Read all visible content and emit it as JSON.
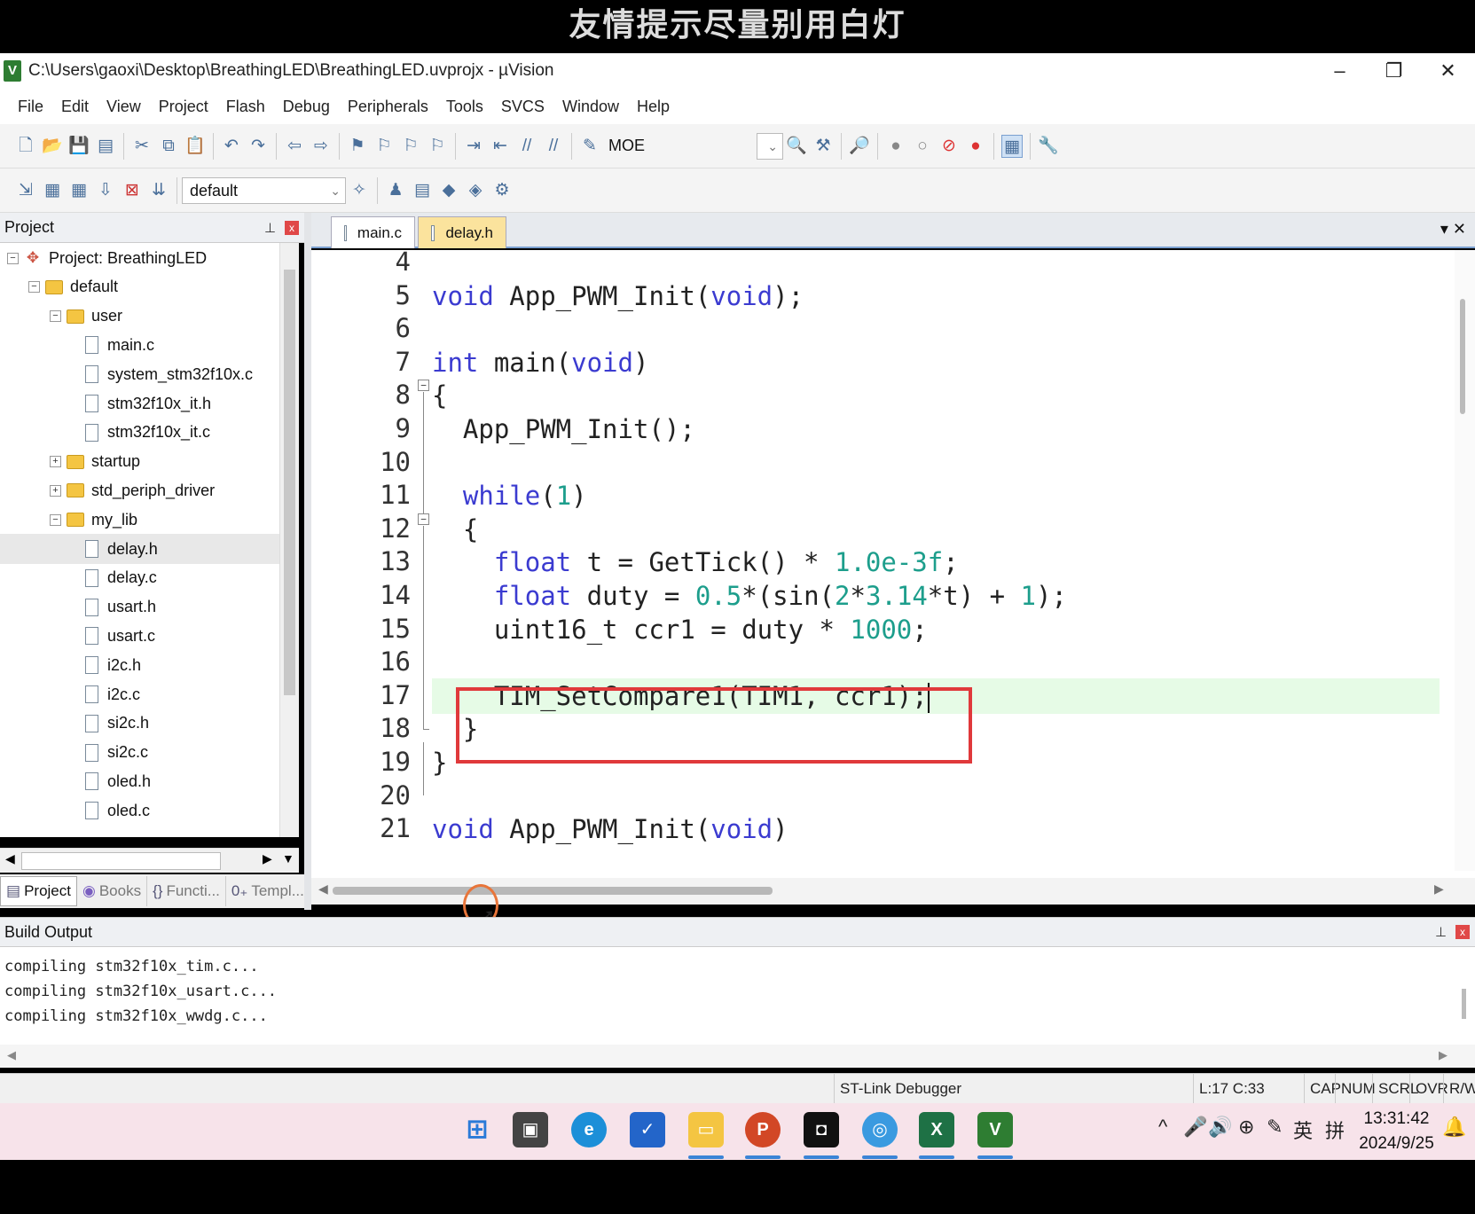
{
  "overlay_banner": "友情提示尽量别用白灯",
  "window": {
    "title": "C:\\Users\\gaoxi\\Desktop\\BreathingLED\\BreathingLED.uvprojx - µVision",
    "app_icon": "V",
    "minimize": "–",
    "restore": "❐",
    "close": "✕"
  },
  "menu": [
    "File",
    "Edit",
    "View",
    "Project",
    "Flash",
    "Debug",
    "Peripherals",
    "Tools",
    "SVCS",
    "Window",
    "Help"
  ],
  "toolbar": {
    "moe_label": "MOE",
    "target_select": "default"
  },
  "project_panel": {
    "title": "Project",
    "pin": "⊥",
    "close": "x",
    "tree": [
      {
        "label": "Project: BreathingLED",
        "type": "project",
        "level": 0,
        "expander": "−"
      },
      {
        "label": "default",
        "type": "group",
        "level": 1,
        "expander": "−"
      },
      {
        "label": "user",
        "type": "folder",
        "level": 2,
        "expander": "−"
      },
      {
        "label": "main.c",
        "type": "file",
        "level": 3
      },
      {
        "label": "system_stm32f10x.c",
        "type": "file",
        "level": 3
      },
      {
        "label": "stm32f10x_it.h",
        "type": "file",
        "level": 3
      },
      {
        "label": "stm32f10x_it.c",
        "type": "file",
        "level": 3
      },
      {
        "label": "startup",
        "type": "folder",
        "level": 2,
        "expander": "+"
      },
      {
        "label": "std_periph_driver",
        "type": "folder",
        "level": 2,
        "expander": "+"
      },
      {
        "label": "my_lib",
        "type": "folder",
        "level": 2,
        "expander": "−"
      },
      {
        "label": "delay.h",
        "type": "file",
        "level": 3,
        "selected": true
      },
      {
        "label": "delay.c",
        "type": "file",
        "level": 3
      },
      {
        "label": "usart.h",
        "type": "file",
        "level": 3
      },
      {
        "label": "usart.c",
        "type": "file",
        "level": 3
      },
      {
        "label": "i2c.h",
        "type": "file",
        "level": 3
      },
      {
        "label": "i2c.c",
        "type": "file",
        "level": 3
      },
      {
        "label": "si2c.h",
        "type": "file",
        "level": 3
      },
      {
        "label": "si2c.c",
        "type": "file",
        "level": 3
      },
      {
        "label": "oled.h",
        "type": "file",
        "level": 3
      },
      {
        "label": "oled.c",
        "type": "file",
        "level": 3
      }
    ],
    "tabs": [
      "Project",
      "Books",
      "Functi...",
      "Templ..."
    ],
    "tab_icons": [
      "▤",
      "◉",
      "{}",
      "0₊"
    ]
  },
  "editor": {
    "tabs": [
      "main.c",
      "delay.h"
    ],
    "tab_controls": "▾  ✕",
    "lines": [
      {
        "n": "4",
        "code": []
      },
      {
        "n": "5",
        "code": [
          [
            "kw",
            "void"
          ],
          [
            "",
            " App_PWM_Init("
          ],
          [
            "kw",
            "void"
          ],
          [
            "",
            ");"
          ]
        ]
      },
      {
        "n": "6",
        "code": []
      },
      {
        "n": "7",
        "code": [
          [
            "kw",
            "int"
          ],
          [
            "",
            " main("
          ],
          [
            "kw",
            "void"
          ],
          [
            "",
            ")"
          ]
        ]
      },
      {
        "n": "8",
        "code": [
          [
            "",
            "{"
          ]
        ]
      },
      {
        "n": "9",
        "code": [
          [
            "",
            "  App_PWM_Init();"
          ]
        ]
      },
      {
        "n": "10",
        "code": []
      },
      {
        "n": "11",
        "code": [
          [
            "",
            "  "
          ],
          [
            "kw",
            "while"
          ],
          [
            "",
            "("
          ],
          [
            "num",
            "1"
          ],
          [
            "",
            ")"
          ]
        ]
      },
      {
        "n": "12",
        "code": [
          [
            "",
            "  {"
          ]
        ]
      },
      {
        "n": "13",
        "code": [
          [
            "",
            "    "
          ],
          [
            "kw",
            "float"
          ],
          [
            "",
            " t = GetTick() * "
          ],
          [
            "num",
            "1.0e-3f"
          ],
          [
            "",
            ";"
          ]
        ]
      },
      {
        "n": "14",
        "code": [
          [
            "",
            "    "
          ],
          [
            "kw",
            "float"
          ],
          [
            "",
            " duty = "
          ],
          [
            "num",
            "0.5"
          ],
          [
            "",
            "*(sin("
          ],
          [
            "num",
            "2"
          ],
          [
            "",
            "*"
          ],
          [
            "num",
            "3.14"
          ],
          [
            "",
            "*t) + "
          ],
          [
            "num",
            "1"
          ],
          [
            "",
            ");"
          ]
        ]
      },
      {
        "n": "15",
        "code": [
          [
            "",
            "    uint16_t ccr1 = duty * "
          ],
          [
            "num",
            "1000"
          ],
          [
            "",
            ";"
          ]
        ]
      },
      {
        "n": "16",
        "code": []
      },
      {
        "n": "17",
        "code": [
          [
            "",
            "    TIM_SetCompare1(TIM1, ccr1);"
          ]
        ],
        "current": true
      },
      {
        "n": "18",
        "code": [
          [
            "",
            "  }"
          ]
        ]
      },
      {
        "n": "19",
        "code": [
          [
            "",
            "}"
          ]
        ]
      },
      {
        "n": "20",
        "code": []
      },
      {
        "n": "21",
        "code": [
          [
            "kw",
            "void"
          ],
          [
            "",
            " App_PWM_Init("
          ],
          [
            "kw",
            "void"
          ],
          [
            "",
            ")"
          ]
        ]
      }
    ]
  },
  "build_output": {
    "title": "Build Output",
    "lines": [
      "compiling stm32f10x_tim.c...",
      "compiling stm32f10x_usart.c...",
      "compiling stm32f10x_wwdg.c..."
    ]
  },
  "status": {
    "debugger": "ST-Link Debugger",
    "position": "L:17 C:33",
    "cap": "CAP",
    "num": "NUM",
    "scrl": "SCRL",
    "ovr": "OVR",
    "rw": "R/W"
  },
  "taskbar": {
    "apps": [
      "windows-start",
      "file-manager",
      "edge",
      "whiteboard",
      "explorer-folder",
      "powerpoint",
      "camera",
      "browser",
      "excel",
      "keil-uvision"
    ],
    "tray": [
      "^",
      "🎤",
      "🔊",
      "⊕",
      "✎",
      "英",
      "拼"
    ],
    "time": "13:31:42",
    "date": "2024/9/25"
  }
}
